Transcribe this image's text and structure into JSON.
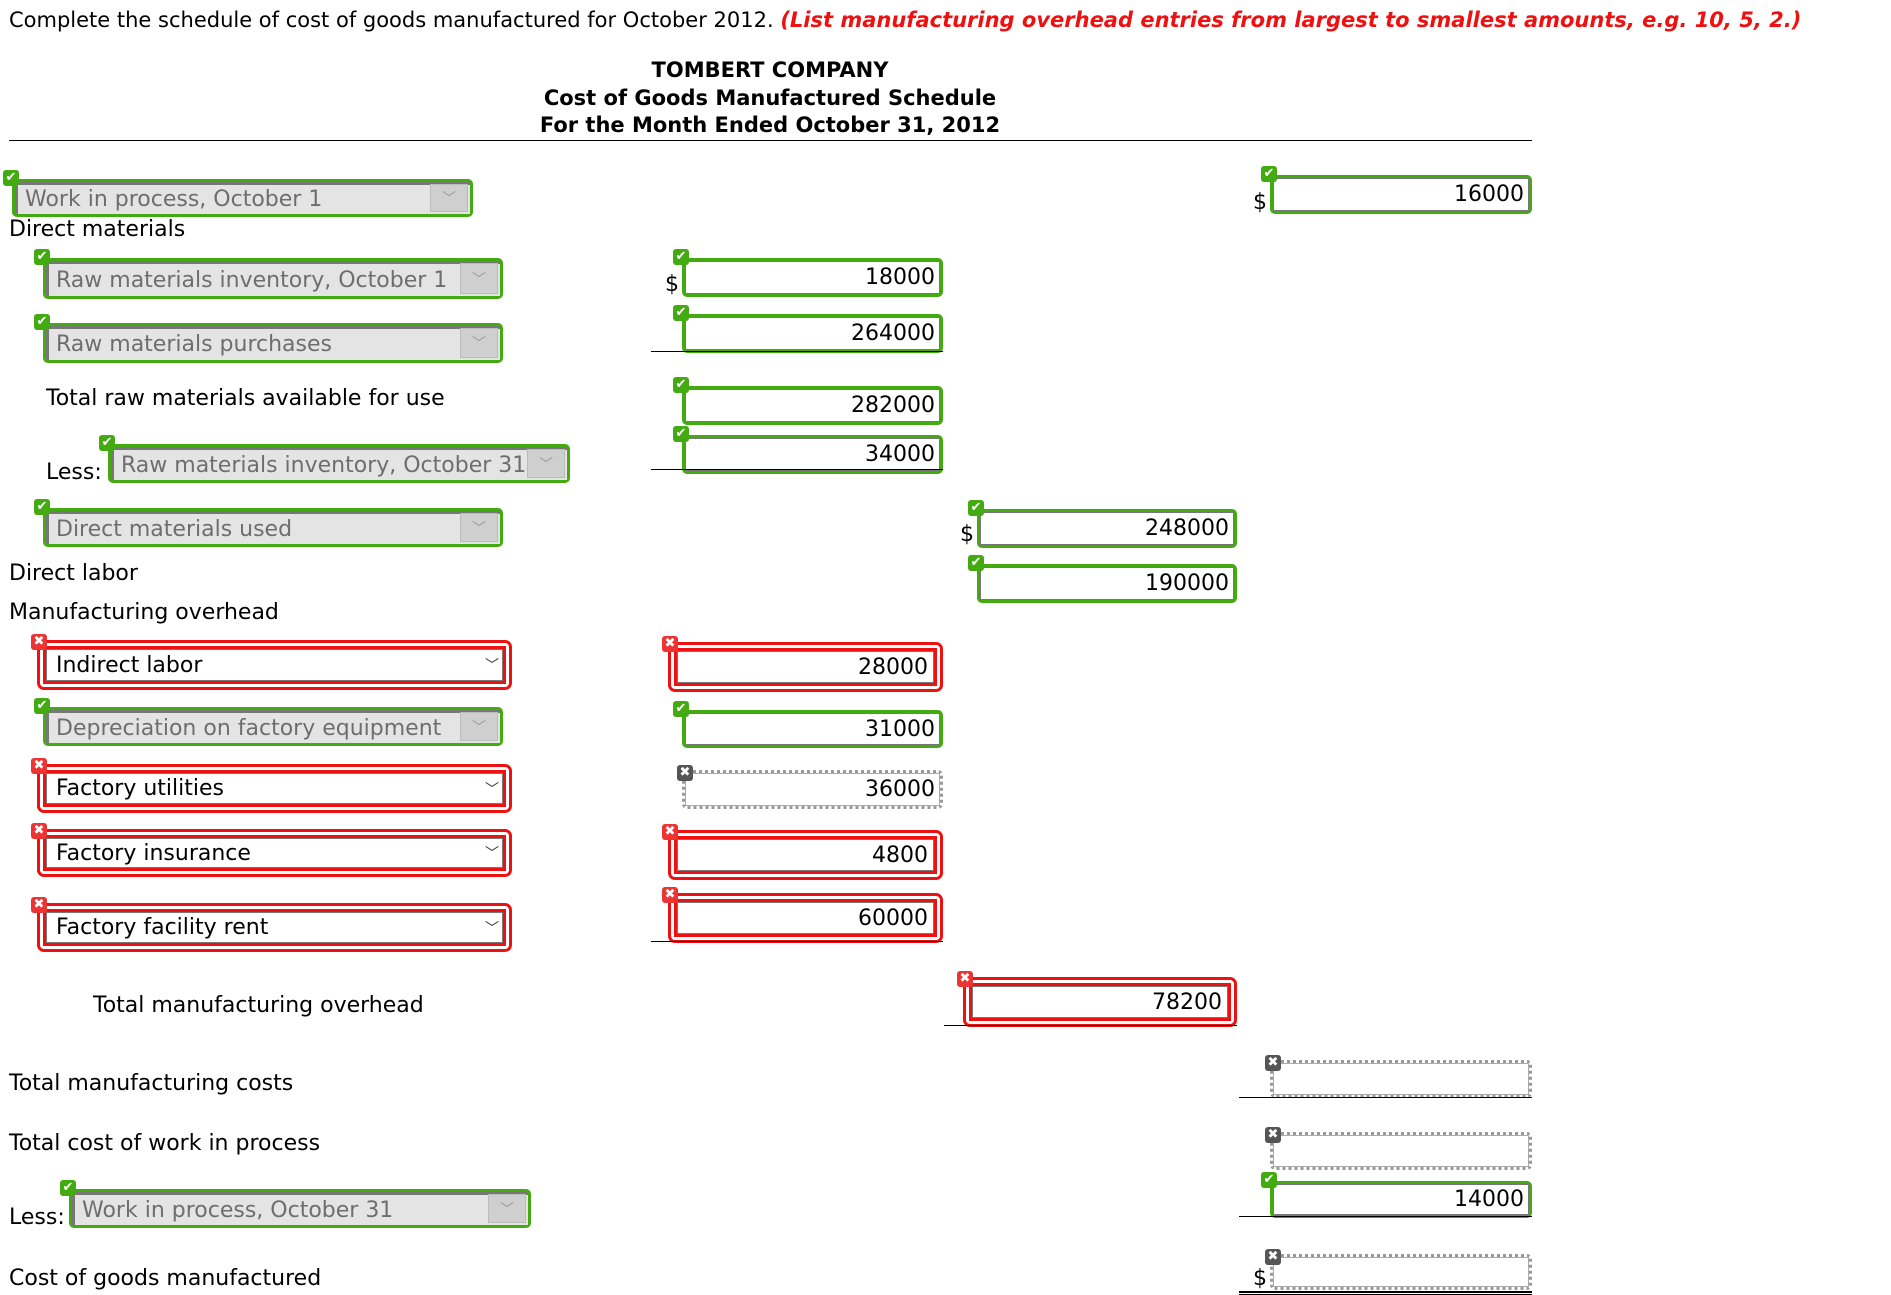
{
  "instruction": {
    "text": "Complete the schedule of cost of goods manufactured for October 2012.",
    "note": "(List manufacturing overhead entries from largest to smallest amounts, e.g. 10, 5, 2.)"
  },
  "header": {
    "company": "TOMBERT COMPANY",
    "statement": "Cost of Goods Manufactured Schedule",
    "period": "For the Month Ended October 31, 2012"
  },
  "labels": {
    "direct_materials": "Direct materials",
    "total_raw_available": "Total raw materials available for use",
    "less": "Less:",
    "direct_labor": "Direct labor",
    "manufacturing_overhead": "Manufacturing overhead",
    "total_mfg_overhead": "Total manufacturing overhead",
    "total_mfg_costs": "Total manufacturing costs",
    "total_cost_wip": "Total cost of work in process",
    "cogm": "Cost of goods manufactured",
    "currency": "$"
  },
  "dropdowns": {
    "wip_oct1": {
      "value": "Work in process, October 1",
      "status": "correct"
    },
    "rm_inv_oct1": {
      "value": "Raw materials inventory, October 1",
      "status": "correct"
    },
    "rm_purchases": {
      "value": "Raw materials purchases",
      "status": "correct"
    },
    "rm_inv_oct31": {
      "value": "Raw materials inventory, October 31",
      "status": "correct"
    },
    "dm_used": {
      "value": "Direct materials used",
      "status": "correct"
    },
    "oh1": {
      "value": "Indirect labor",
      "status": "incorrect"
    },
    "oh2": {
      "value": "Depreciation on factory equipment",
      "status": "correct"
    },
    "oh3": {
      "value": "Factory utilities",
      "status": "incorrect"
    },
    "oh4": {
      "value": "Factory insurance",
      "status": "incorrect"
    },
    "oh5": {
      "value": "Factory facility rent",
      "status": "incorrect"
    },
    "wip_oct31": {
      "value": "Work in process, October 31",
      "status": "correct"
    }
  },
  "amounts": {
    "wip_oct1": {
      "value": "16000",
      "status": "correct"
    },
    "rm_inv_oct1": {
      "value": "18000",
      "status": "correct"
    },
    "rm_purchases": {
      "value": "264000",
      "status": "correct"
    },
    "total_raw_available": {
      "value": "282000",
      "status": "correct"
    },
    "rm_inv_oct31": {
      "value": "34000",
      "status": "correct"
    },
    "dm_used": {
      "value": "248000",
      "status": "correct"
    },
    "direct_labor": {
      "value": "190000",
      "status": "correct"
    },
    "oh1": {
      "value": "28000",
      "status": "incorrect"
    },
    "oh2": {
      "value": "31000",
      "status": "correct"
    },
    "oh3": {
      "value": "36000",
      "status": "unanswered"
    },
    "oh4": {
      "value": "4800",
      "status": "incorrect"
    },
    "oh5": {
      "value": "60000",
      "status": "incorrect"
    },
    "total_mfg_overhead": {
      "value": "78200",
      "status": "incorrect"
    },
    "total_mfg_costs": {
      "value": "",
      "status": "unanswered"
    },
    "total_cost_wip": {
      "value": "",
      "status": "unanswered"
    },
    "wip_oct31": {
      "value": "14000",
      "status": "correct"
    },
    "cogm": {
      "value": "",
      "status": "unanswered"
    }
  },
  "status_icons": {
    "correct": "✔",
    "incorrect": "✖",
    "unanswered": "✖"
  },
  "colors": {
    "correct": "#44aa11",
    "incorrect": "#ee1111",
    "unanswered": "#999999",
    "instruction_note": "#ee1111"
  }
}
